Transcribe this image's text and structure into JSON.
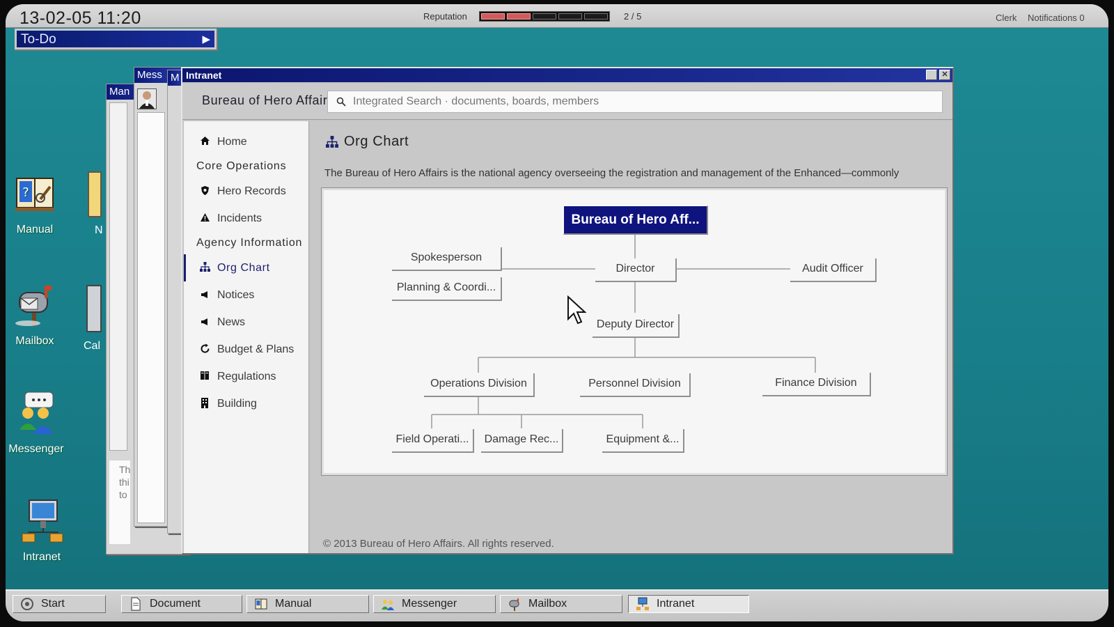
{
  "topbar": {
    "datetime": "13-02-05  11:20",
    "reputation_label": "Reputation",
    "reputation_value": 2,
    "reputation_max": 5,
    "reputation_text": "2 / 5",
    "role": "Clerk",
    "notifications": "Notifications 0"
  },
  "todo": {
    "label": "To-Do",
    "arrow": "▶"
  },
  "desktop_icons": [
    {
      "label": "Manual",
      "icon": "manual-book-icon"
    },
    {
      "label": "Mailbox",
      "icon": "mailbox-icon"
    },
    {
      "label": "Messenger",
      "icon": "messenger-icon"
    },
    {
      "label": "Intranet",
      "icon": "intranet-network-icon"
    }
  ],
  "partial_icon_labels": [
    "N",
    "Cal"
  ],
  "background_windows": {
    "messenger_title": "Mess",
    "manual_title": "Man",
    "doc_title": "M",
    "text_fragments": [
      "Th",
      "thi",
      "to"
    ]
  },
  "window": {
    "title": "Intranet",
    "brand": "Bureau of Hero Affairs",
    "search_placeholder": "Integrated Search · documents, boards, members"
  },
  "sidebar": {
    "home": "Home",
    "group_core": "Core Operations",
    "core_items": [
      {
        "label": "Hero Records",
        "icon": "shield-icon"
      },
      {
        "label": "Incidents",
        "icon": "warning-icon"
      }
    ],
    "group_agency": "Agency Information",
    "agency_items": [
      {
        "label": "Org Chart",
        "icon": "org-chart-icon",
        "active": true
      },
      {
        "label": "Notices",
        "icon": "megaphone-icon"
      },
      {
        "label": "News",
        "icon": "megaphone-icon"
      },
      {
        "label": "Budget & Plans",
        "icon": "refresh-icon"
      },
      {
        "label": "Regulations",
        "icon": "book-icon"
      },
      {
        "label": "Building",
        "icon": "building-icon"
      }
    ]
  },
  "content": {
    "title": "Org Chart",
    "description": "The Bureau of Hero Affairs is the national agency overseeing the registration and management of the Enhanced—commonly",
    "footer": "© 2013 Bureau of Hero Affairs. All rights reserved."
  },
  "org": {
    "root": "Bureau of Hero Aff...",
    "spokesperson": "Spokesperson",
    "planning": "Planning & Coordi...",
    "director": "Director",
    "audit": "Audit Officer",
    "deputy": "Deputy Director",
    "operations": "Operations Division",
    "personnel": "Personnel Division",
    "finance": "Finance Division",
    "field": "Field Operati...",
    "damage": "Damage Rec...",
    "equipment": "Equipment &..."
  },
  "taskbar": {
    "start": "Start",
    "items": [
      "Document",
      "Manual",
      "Messenger",
      "Mailbox",
      "Intranet"
    ],
    "active": "Intranet"
  },
  "colors": {
    "desktop": "#1a8590",
    "titlebar": "#0c1670",
    "accent_nav": "#1a1f6b",
    "reputation_on": "#d35a5a"
  }
}
